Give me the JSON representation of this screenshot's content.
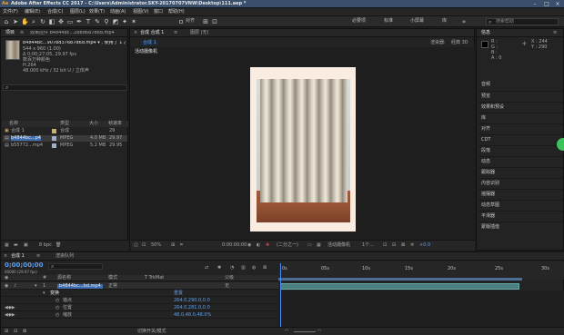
{
  "window": {
    "title": "Adobe After Effects CC 2017 - C:\\Users\\Administrator.SKY-20170707VNW\\Desktop\\111.aep *"
  },
  "menu": [
    "文件(F)",
    "编辑(E)",
    "合成(C)",
    "图层(L)",
    "效果(T)",
    "动画(A)",
    "视图(V)",
    "窗口",
    "帮助(H)"
  ],
  "toolbar": {
    "tools": [
      "home-icon",
      "selection-tool-icon",
      "hand-tool-icon",
      "zoom-tool-icon",
      "rotate-tool-icon",
      "camera-tool-icon",
      "pan-behind-icon",
      "rectangle-tool-icon",
      "pen-tool-icon",
      "text-tool-icon",
      "brush-tool-icon",
      "clone-stamp-icon",
      "eraser-icon",
      "roto-brush-icon",
      "puppet-pin-icon"
    ],
    "align_label": "对齐",
    "workspaces": [
      "必要项",
      "标准",
      "小屏幕",
      "库"
    ],
    "search_placeholder": "搜索帮助"
  },
  "project": {
    "tab": "项目",
    "tab_close": "≡",
    "effects_tab": "效果控件 b4844bc...2b8d6b7d6d.mp4",
    "file_name": "b4844bc...907bd376b7d6d.mp4 ▾ , 使用了 1 次",
    "info_lines": [
      "544 x 960 (1.00)",
      "Δ 0;00;27;05, 29.97 fps",
      "数百万种颜色",
      "H.264",
      "48.000 kHz / 32 bit U / 立体声"
    ],
    "search_placeholder": "",
    "columns": [
      "名称",
      "类型",
      "大小",
      "帧速率"
    ],
    "items": [
      {
        "name": "合成 1",
        "type": "合成",
        "size": "",
        "fps": "29",
        "color": "#c9b26a"
      },
      {
        "name": "b4844bc...p4",
        "type": "MPEG",
        "size": "4.0 MB",
        "fps": "29.97",
        "color": "#9fb0c8"
      },
      {
        "name": "b55772...mp4",
        "type": "MPEG",
        "size": "5.2 MB",
        "fps": "29.95",
        "color": "#9fb0c8"
      }
    ],
    "bpc": "8 bpc"
  },
  "comp": {
    "tab": "合成 合成 1",
    "tab_close": "≡",
    "layer_tab": "图层 (无)",
    "subtab": "合成 1",
    "renderer_label": "渲染器:",
    "renderer_value": "经典 3D",
    "camera_label": "活动摄像机",
    "zoom": "50%",
    "time": "0:00:00:00",
    "quality": "(二分之一)",
    "view_camera": "活动摄像机",
    "views": "1个...",
    "exposure": "+0.0"
  },
  "right_panel": {
    "info_tab": "信息",
    "readout": {
      "r": "R :",
      "g": "G :",
      "b": "B :",
      "a": "A : 0",
      "x": "X : 244",
      "y": "Y : 290"
    },
    "items": [
      "音频",
      "预览",
      "效果和预设",
      "库",
      "对齐",
      "CDT",
      "段落",
      "动态",
      "跟踪器",
      "内容识别",
      "摇摆器",
      "动态草图",
      "平滑器",
      "蒙版插值"
    ]
  },
  "timeline": {
    "tab": "合成 1",
    "render_tab": "渲染队列",
    "timecode": "0;00;00;00",
    "fps_hint": "00000 (29.97 fps)",
    "columns": [
      "#",
      "源名称",
      "模式",
      "T TrkMat",
      "父级"
    ],
    "rows": [
      {
        "num": "1",
        "name": "b4844bc...bd.mp4",
        "mode": "正常",
        "parent": "无"
      },
      {
        "num": "",
        "name": "变换",
        "mode": "",
        "parent": "重置"
      },
      {
        "num": "",
        "name": "锚点",
        "mode": "",
        "parent": "264.0,290.0,0.0"
      },
      {
        "num": "",
        "name": "位置",
        "mode": "",
        "parent": "264.0,281.0,0.0"
      },
      {
        "num": "",
        "name": "缩放",
        "mode": "",
        "parent": "48.0,48.0,48.0%"
      }
    ],
    "ruler": [
      "0s",
      "05s",
      "10s",
      "15s",
      "20s",
      "25s",
      "30s"
    ],
    "footer": "切换开关/模式"
  }
}
